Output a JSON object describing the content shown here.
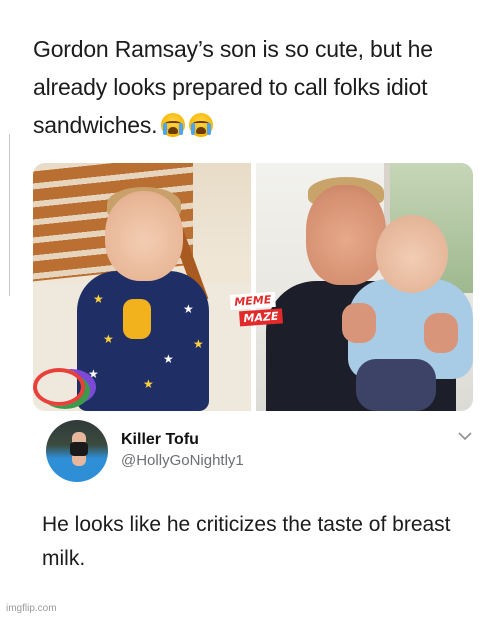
{
  "tweet": {
    "text": "Gordon Ramsay’s son is so cute, but he already looks prepared to call folks idiot sandwiches.",
    "emoji_icons": [
      "loudly-crying-face-icon",
      "loudly-crying-face-icon"
    ]
  },
  "media": {
    "images": [
      {
        "name": "baby-on-beach-photo"
      },
      {
        "name": "gordon-holding-baby-photo"
      }
    ],
    "watermark": {
      "line1": "MEME",
      "line2": "MAZE"
    }
  },
  "reply": {
    "name": "Killer Tofu",
    "handle": "@HollyGoNightly1",
    "text": "He looks like he criticizes the taste of breast milk.",
    "menu_icon": "chevron-down-icon"
  },
  "footer": {
    "watermark": "imgflip.com"
  },
  "colors": {
    "text": "#1c1c1c",
    "handle": "#6b6f73",
    "watermark_red": "#e22a2a"
  }
}
